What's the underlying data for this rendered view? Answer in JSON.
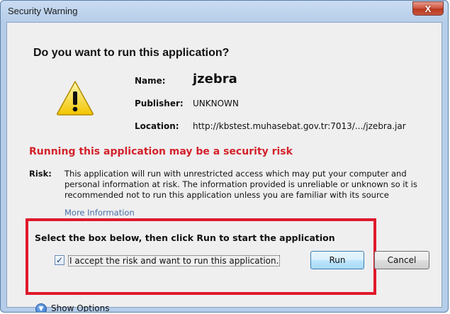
{
  "window": {
    "title": "Security Warning",
    "close_glyph": "X",
    "headline": "Do you want to run this application?"
  },
  "icon": {
    "warning": "warning-triangle-icon"
  },
  "details": {
    "name_label": "Name:",
    "name_value": "jzebra",
    "publisher_label": "Publisher:",
    "publisher_value": "UNKNOWN",
    "location_label": "Location:",
    "location_value": "http://kbstest.muhasebat.gov.tr:7013/.../jzebra.jar"
  },
  "risk": {
    "title": "Running this application may be a security risk",
    "label": "Risk:",
    "text": "This application will run with unrestricted access which may put your computer and personal information at risk. The information provided is unreliable or unknown so it is recommended not to run this application unless you are familiar with its source",
    "more_info": "More Information"
  },
  "consent": {
    "instruction": "Select the box below, then click Run to start the application",
    "checkbox_checked": true,
    "checkbox_label": "I accept the risk and want to run this application."
  },
  "buttons": {
    "run": "Run",
    "cancel": "Cancel",
    "show_options": "Show Options"
  },
  "colors": {
    "risk_red": "#d3222a",
    "highlight_red": "#e0192b",
    "link_blue": "#4a6fa5"
  }
}
